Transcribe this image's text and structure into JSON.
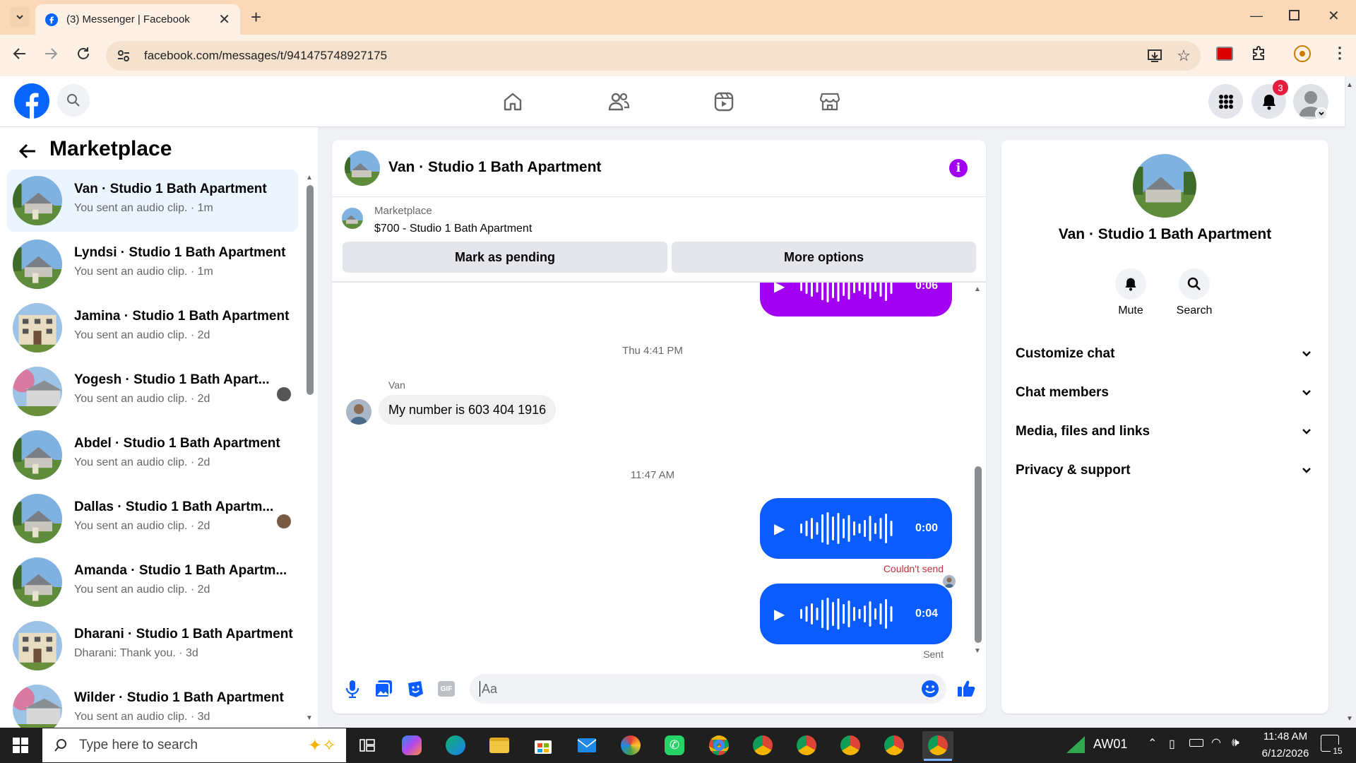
{
  "browser": {
    "tab_title": "(3) Messenger | Facebook",
    "url": "facebook.com/messages/t/941475748927175"
  },
  "header": {
    "notification_count": "3"
  },
  "sidebar": {
    "title": "Marketplace",
    "conversations": [
      {
        "name": "Van · Studio 1 Bath Apartment",
        "subtitle": "You sent an audio clip. · 1m"
      },
      {
        "name": "Lyndsi · Studio 1 Bath Apartment",
        "subtitle": "You sent an audio clip. · 1m"
      },
      {
        "name": "Jamina · Studio 1 Bath Apartment",
        "subtitle": "You sent an audio clip. · 2d"
      },
      {
        "name": "Yogesh · Studio 1 Bath Apart...",
        "subtitle": "You sent an audio clip. · 2d"
      },
      {
        "name": "Abdel · Studio 1 Bath Apartment",
        "subtitle": "You sent an audio clip. · 2d"
      },
      {
        "name": "Dallas · Studio 1 Bath Apartm...",
        "subtitle": "You sent an audio clip. · 2d"
      },
      {
        "name": "Amanda · Studio 1 Bath Apartm...",
        "subtitle": "You sent an audio clip. · 2d"
      },
      {
        "name": "Dharani · Studio 1 Bath Apartment",
        "subtitle": "Dharani: Thank you. · 3d"
      },
      {
        "name": "Wilder · Studio 1 Bath Apartment",
        "subtitle": "You sent an audio clip. · 3d"
      }
    ]
  },
  "chat": {
    "title": "Van · Studio 1 Bath Apartment",
    "listing_label": "Marketplace",
    "listing_title": "$700 - Studio 1 Bath Apartment",
    "mark_pending": "Mark as pending",
    "more_options": "More options",
    "messages": {
      "audio_top_duration": "0:06",
      "timestamp_1": "Thu 4:41 PM",
      "sender": "Van",
      "text_message": "My number is 603 404 1916",
      "timestamp_2": "11:47 AM",
      "audio_failed_duration": "0:00",
      "failed_status": "Couldn't send",
      "audio_sent_duration": "0:04",
      "sent_status": "Sent"
    },
    "composer_placeholder": "Aa"
  },
  "info": {
    "name": "Van · Studio 1 Bath Apartment",
    "mute_label": "Mute",
    "search_label": "Search",
    "sections": [
      "Customize chat",
      "Chat members",
      "Media, files and links",
      "Privacy & support"
    ]
  },
  "taskbar": {
    "search_placeholder": "Type here to search",
    "network_label": "AW01",
    "time": "11:48 AM",
    "date": "6/12/2026",
    "notification_count": "15"
  },
  "colors": {
    "fb_blue": "#0866ff",
    "audio_purple": "#a100f2",
    "audio_blue": "#0a5cff",
    "error_red": "#c72e3f",
    "active_conv": "#ebf5ff"
  }
}
